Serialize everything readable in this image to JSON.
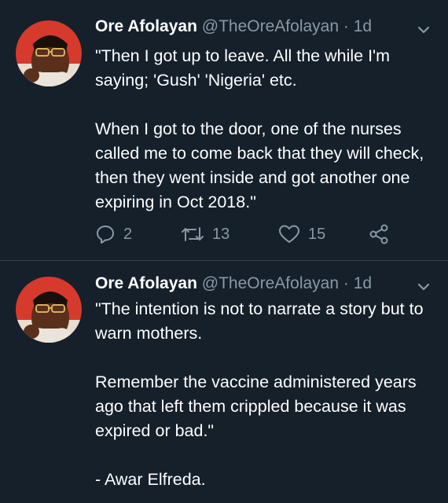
{
  "tweets": [
    {
      "name": "Ore Afolayan",
      "handle": "@TheOreAfolayan",
      "dot": "·",
      "time": "1d",
      "caret_icon": "chevron-down-icon",
      "text": "\"Then I got up to leave. All the while I'm saying; 'Gush' 'Nigeria' etc.\n\nWhen I got to the door, one of the nurses called me to come back that they will check, then they went inside and got another one expiring in Oct 2018.\"",
      "actions": {
        "reply_icon": "reply-icon",
        "reply_count": "2",
        "retweet_icon": "retweet-icon",
        "retweet_count": "13",
        "like_icon": "heart-icon",
        "like_count": "15",
        "share_icon": "share-icon"
      }
    },
    {
      "name": "Ore Afolayan",
      "handle": "@TheOreAfolayan",
      "dot": "·",
      "time": "1d",
      "caret_icon": "chevron-down-icon",
      "text": "\"The intention is not to narrate a story but to warn mothers.\n\nRemember the vaccine administered years ago that left them crippled because it was expired or bad.\"\n\n- Awar Elfreda."
    }
  ],
  "colors": {
    "background": "#15202b",
    "text": "#ffffff",
    "secondary": "#8899a6",
    "divider": "#38444d",
    "avatar_bg": "#d63a2c"
  }
}
